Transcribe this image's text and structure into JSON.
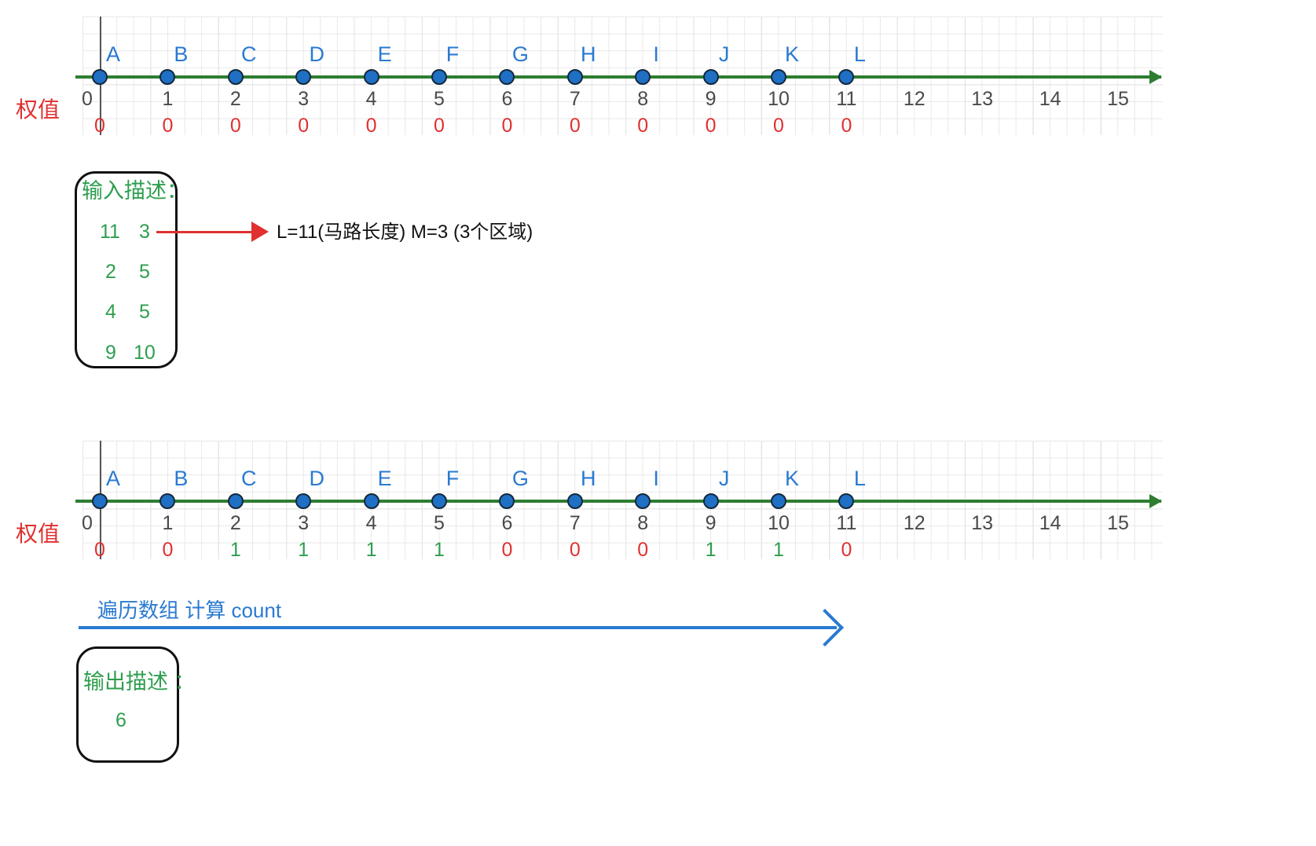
{
  "meta": {
    "title": "马路区域权值标记示意图",
    "colors": {
      "node": "#1f6fc4",
      "node_label": "#2a7ad1",
      "axis": "#2e7d32",
      "weight_zero": "#e03030",
      "weight_one": "#2e9e4f",
      "tick": "#4a4a4a",
      "box_border": "#111111",
      "box_text": "#2e9e4f",
      "red_arrow": "#e03030",
      "blue_arrow": "#2a7ad1"
    }
  },
  "axis": {
    "tick_labels": [
      "0",
      "1",
      "2",
      "3",
      "4",
      "5",
      "6",
      "7",
      "8",
      "9",
      "10",
      "11",
      "12",
      "13",
      "14",
      "15"
    ],
    "node_labels": [
      "A",
      "B",
      "C",
      "D",
      "E",
      "F",
      "G",
      "H",
      "I",
      "J",
      "K",
      "L"
    ],
    "min": 0,
    "max": 15,
    "node_count": 12,
    "arrow_head": "arrow-right"
  },
  "row_caption": "权值",
  "line1": {
    "caption": "权值",
    "weights": [
      "0",
      "0",
      "0",
      "0",
      "0",
      "0",
      "0",
      "0",
      "0",
      "0",
      "0",
      "0"
    ],
    "weight_flags": [
      0,
      0,
      0,
      0,
      0,
      0,
      0,
      0,
      0,
      0,
      0,
      0
    ]
  },
  "line2": {
    "caption": "权值",
    "weights": [
      "0",
      "0",
      "1",
      "1",
      "1",
      "1",
      "0",
      "0",
      "0",
      "1",
      "1",
      "0"
    ],
    "weight_flags": [
      0,
      0,
      1,
      1,
      1,
      1,
      0,
      0,
      0,
      1,
      1,
      0
    ]
  },
  "input_box": {
    "title": "输入描述：",
    "rows": [
      {
        "a": "11",
        "b": "3"
      },
      {
        "a": "2",
        "b": "5"
      },
      {
        "a": "4",
        "b": "5"
      },
      {
        "a": "9",
        "b": "10"
      }
    ]
  },
  "input_annotation": "L=11(马路长度)   M=3 (3个区域)",
  "traverse_note": "遍历数组 计算 count",
  "output_box": {
    "title": "输出描述 ：",
    "value": "6"
  }
}
